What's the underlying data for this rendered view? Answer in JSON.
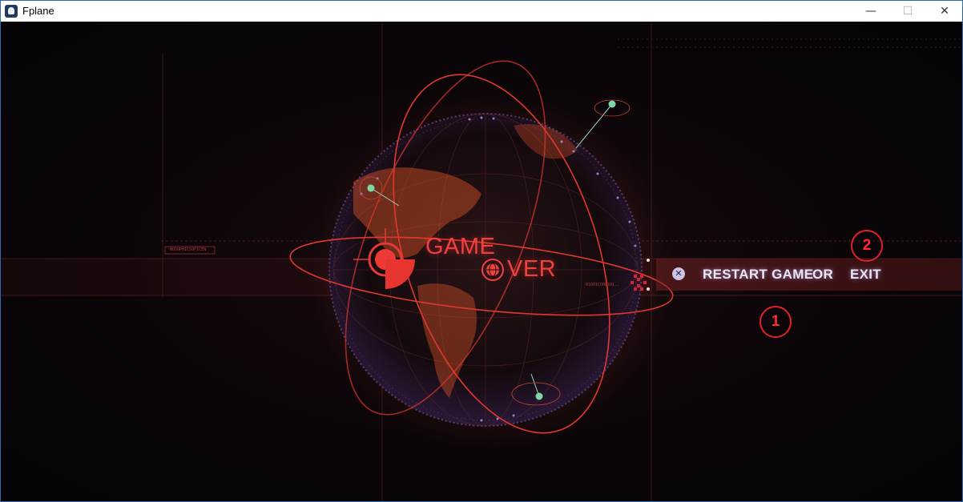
{
  "window": {
    "title": "Fplane",
    "controls": {
      "minimize": "—",
      "maximize": "☐",
      "close": "✕"
    }
  },
  "game": {
    "headline_line1": "GAME",
    "headline_line2": "VER",
    "hud_tag": "NOSOPHICSOFICEN",
    "binary_tag": "01001CORD101..",
    "menu": {
      "restart_label": "RESTART GAME",
      "or_label": "OR",
      "exit_label": "EXIT"
    },
    "callouts": {
      "first": "1",
      "second": "2"
    }
  },
  "colors": {
    "accent_red": "#f0413f",
    "callout_red": "#e0202a",
    "menu_text": "#e9e6f2",
    "node_green": "#7fd6a6",
    "globe_dots": "#b69cf0"
  }
}
